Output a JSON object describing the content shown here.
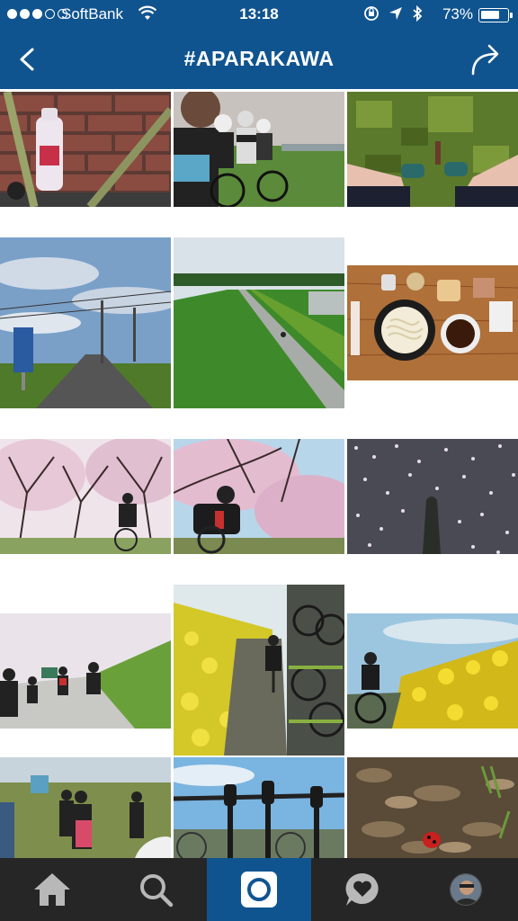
{
  "status_bar": {
    "carrier": "SoftBank",
    "time": "13:18",
    "battery_percent": "73%",
    "battery_level": 0.73
  },
  "nav": {
    "title": "#APARAKAWA",
    "back_icon": "chevron-left-icon",
    "share_icon": "share-arrow-icon"
  },
  "photos": [
    {
      "subject": "water bottle on bike frame against brick wall"
    },
    {
      "subject": "cyclists riding in a group"
    },
    {
      "subject": "legs and cycling shoes on grass"
    },
    {
      "subject": "road with power lines and sky"
    },
    {
      "subject": "riverside embankment cycling path"
    },
    {
      "subject": "bowl of udon noodles on table"
    },
    {
      "subject": "cherry blossom trees with rider"
    },
    {
      "subject": "cyclist under cherry blossoms"
    },
    {
      "subject": "shadow on road with fallen petals"
    },
    {
      "subject": "group of riders on grassy embankment"
    },
    {
      "subject": "rapeseed flowers with cyclist and parked bikes"
    },
    {
      "subject": "cyclist beside yellow flowers"
    },
    {
      "subject": "group of cyclists on grass field"
    },
    {
      "subject": "bicycles hanging on rack"
    },
    {
      "subject": "ladybug on dry leaves"
    }
  ],
  "tabbar": {
    "items": [
      {
        "name": "home",
        "icon": "home-icon"
      },
      {
        "name": "search",
        "icon": "search-icon"
      },
      {
        "name": "camera",
        "icon": "camera-icon",
        "active": true
      },
      {
        "name": "activity",
        "icon": "heart-bubble-icon"
      },
      {
        "name": "profile",
        "icon": "avatar"
      }
    ]
  },
  "colors": {
    "brand_blue": "#10548f",
    "tabbar_bg": "#262626"
  }
}
